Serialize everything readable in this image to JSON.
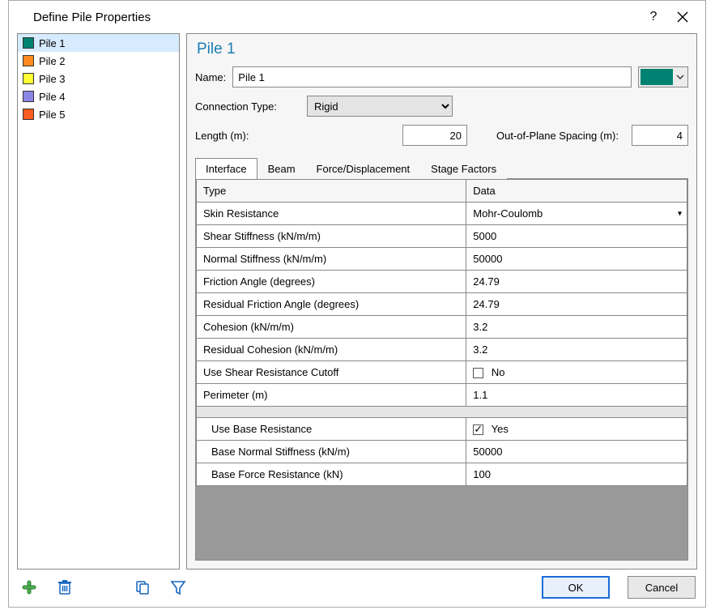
{
  "window": {
    "title": "Define Pile Properties"
  },
  "sidebar": {
    "items": [
      {
        "label": "Pile 1",
        "color": "#008272",
        "selected": true
      },
      {
        "label": "Pile 2",
        "color": "#ff8a1f",
        "selected": false
      },
      {
        "label": "Pile 3",
        "color": "#ffff33",
        "selected": false
      },
      {
        "label": "Pile 4",
        "color": "#8a86e6",
        "selected": false
      },
      {
        "label": "Pile 5",
        "color": "#ff5a1f",
        "selected": false
      }
    ]
  },
  "main": {
    "heading": "Pile 1",
    "name_label": "Name:",
    "name_value": "Pile 1",
    "color_value": "#008272",
    "connection_label": "Connection Type:",
    "connection_value": "Rigid",
    "length_label": "Length (m):",
    "length_value": "20",
    "oop_label": "Out-of-Plane Spacing (m):",
    "oop_value": "4",
    "tabs": [
      "Interface",
      "Beam",
      "Force/Displacement",
      "Stage Factors"
    ],
    "active_tab": 0,
    "grid": {
      "headers": [
        "Type",
        "Data"
      ],
      "rows": [
        {
          "type": "Skin Resistance",
          "data": "Mohr-Coulomb",
          "dropdown": true
        },
        {
          "type": "Shear Stiffness (kN/m/m)",
          "data": "5000"
        },
        {
          "type": "Normal Stiffness (kN/m/m)",
          "data": "50000"
        },
        {
          "type": "Friction Angle (degrees)",
          "data": "24.79"
        },
        {
          "type": "Residual Friction Angle (degrees)",
          "data": "24.79"
        },
        {
          "type": "Cohesion (kN/m/m)",
          "data": "3.2"
        },
        {
          "type": "Residual Cohesion (kN/m/m)",
          "data": "3.2"
        },
        {
          "type": "Use Shear Resistance Cutoff",
          "data": "No",
          "checkbox": true,
          "checked": false
        },
        {
          "type": "Perimeter (m)",
          "data": "1.1"
        }
      ],
      "rows2": [
        {
          "type": "Use Base Resistance",
          "data": "Yes",
          "checkbox": true,
          "checked": true
        },
        {
          "type": "Base Normal Stiffness (kN/m)",
          "data": "50000"
        },
        {
          "type": "Base Force Resistance (kN)",
          "data": "100"
        }
      ]
    }
  },
  "bottom_toolbar": {
    "add_icon": "plus-icon",
    "delete_icon": "trash-icon",
    "copy_icon": "copy-icon",
    "filter_icon": "funnel-icon"
  },
  "buttons": {
    "ok": "OK",
    "cancel": "Cancel"
  }
}
